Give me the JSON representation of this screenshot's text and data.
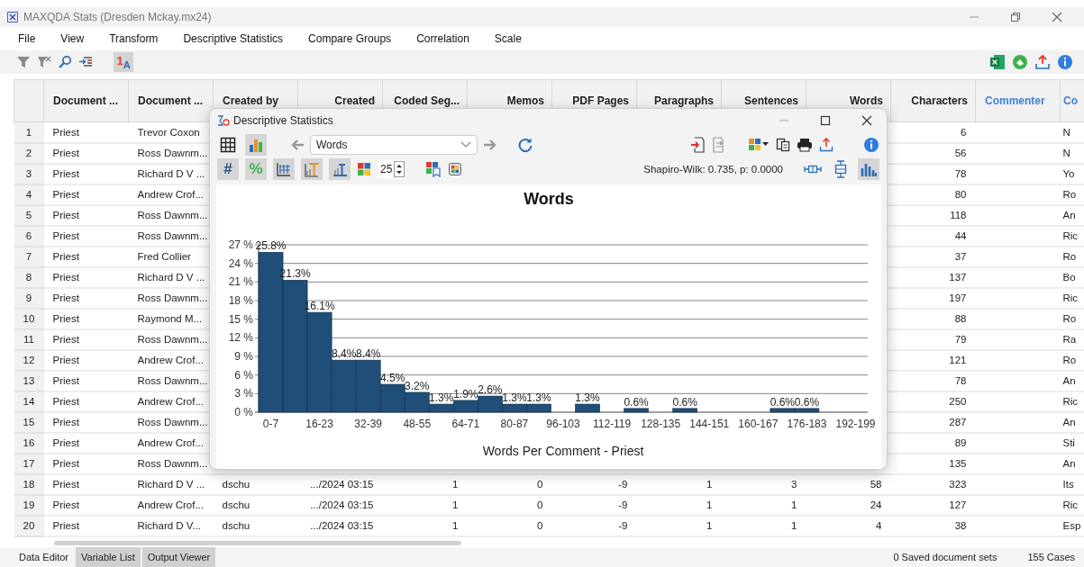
{
  "window": {
    "title": "MAXQDA Stats (Dresden Mckay.mx24)"
  },
  "menu": [
    "File",
    "View",
    "Transform",
    "Descriptive Statistics",
    "Compare Groups",
    "Correlation",
    "Scale"
  ],
  "toolbar": {
    "sort_button": {
      "label": "1$_{A}$",
      "selected": true
    }
  },
  "table": {
    "columns": [
      {
        "kind": "number"
      },
      {
        "label": "Document ...",
        "kind": "text"
      },
      {
        "label": "Document ...",
        "kind": "text"
      },
      {
        "label": "Created by",
        "kind": "text"
      },
      {
        "label": "Created",
        "kind": "number"
      },
      {
        "label": "Coded Seg...",
        "kind": "number"
      },
      {
        "label": "Memos",
        "kind": "number"
      },
      {
        "label": "PDF Pages",
        "kind": "number"
      },
      {
        "label": "Paragraphs",
        "kind": "number"
      },
      {
        "label": "Sentences",
        "kind": "number"
      },
      {
        "label": "Words",
        "kind": "number"
      },
      {
        "label": "Characters",
        "kind": "number"
      },
      {
        "label": "Commenter",
        "kind": "variable"
      },
      {
        "label": "Co",
        "kind": "variable"
      }
    ],
    "rows": [
      [
        "1",
        "Priest",
        "Trevor Coxon",
        null,
        null,
        null,
        null,
        null,
        null,
        null,
        null,
        "6",
        null,
        "N"
      ],
      [
        "2",
        "Priest",
        "Ross Dawnm...",
        null,
        null,
        null,
        null,
        null,
        null,
        null,
        null,
        "56",
        null,
        "N"
      ],
      [
        "3",
        "Priest",
        "Richard D V ...",
        null,
        null,
        null,
        null,
        null,
        null,
        null,
        null,
        "78",
        null,
        "Yo"
      ],
      [
        "4",
        "Priest",
        "Andrew Crof...",
        null,
        null,
        null,
        null,
        null,
        null,
        null,
        null,
        "80",
        null,
        "Ro"
      ],
      [
        "5",
        "Priest",
        "Ross Dawnm...",
        null,
        null,
        null,
        null,
        null,
        null,
        null,
        null,
        "118",
        null,
        "An"
      ],
      [
        "6",
        "Priest",
        "Ross Dawnm...",
        null,
        null,
        null,
        null,
        null,
        null,
        null,
        null,
        "44",
        null,
        "Ric"
      ],
      [
        "7",
        "Priest",
        "Fred Collier",
        null,
        null,
        null,
        null,
        null,
        null,
        null,
        null,
        "37",
        null,
        "Ro"
      ],
      [
        "8",
        "Priest",
        "Richard D V ...",
        null,
        null,
        null,
        null,
        null,
        null,
        null,
        null,
        "137",
        null,
        "Bo"
      ],
      [
        "9",
        "Priest",
        "Ross Dawnm...",
        null,
        null,
        null,
        null,
        null,
        null,
        null,
        null,
        "197",
        null,
        "Ric"
      ],
      [
        "10",
        "Priest",
        "Raymond M...",
        null,
        null,
        null,
        null,
        null,
        null,
        null,
        null,
        "88",
        null,
        "Ro"
      ],
      [
        "11",
        "Priest",
        "Ross Dawnm...",
        null,
        null,
        null,
        null,
        null,
        null,
        null,
        null,
        "79",
        null,
        "Ra"
      ],
      [
        "12",
        "Priest",
        "Andrew Crof...",
        null,
        null,
        null,
        null,
        null,
        null,
        null,
        null,
        "121",
        null,
        "Ro"
      ],
      [
        "13",
        "Priest",
        "Ross Dawnm...",
        null,
        null,
        null,
        null,
        null,
        null,
        null,
        null,
        "78",
        null,
        "An"
      ],
      [
        "14",
        "Priest",
        "Andrew Crof...",
        null,
        null,
        null,
        null,
        null,
        null,
        null,
        null,
        "250",
        null,
        "Ric"
      ],
      [
        "15",
        "Priest",
        "Ross Dawnm...",
        null,
        null,
        null,
        null,
        null,
        null,
        null,
        null,
        "287",
        null,
        "An"
      ],
      [
        "16",
        "Priest",
        "Andrew Crof...",
        null,
        null,
        null,
        null,
        null,
        null,
        null,
        null,
        "89",
        null,
        "Sti"
      ],
      [
        "17",
        "Priest",
        "Ross Dawnm...",
        null,
        null,
        null,
        null,
        null,
        null,
        null,
        null,
        "135",
        null,
        "An"
      ],
      [
        "18",
        "Priest",
        "Richard D V ...",
        "dschu",
        ".../2024 03:15",
        "1",
        "0",
        "-9",
        "1",
        "3",
        "58",
        "323",
        null,
        "Its"
      ],
      [
        "19",
        "Priest",
        "Andrew Crof...",
        "dschu",
        ".../2024 03:15",
        "1",
        "0",
        "-9",
        "1",
        "1",
        "24",
        "127",
        null,
        "Ric"
      ],
      [
        "20",
        "Priest",
        "Richard D V...",
        "dschu",
        ".../2024 03:15",
        "1",
        "0",
        "-9",
        "1",
        "1",
        "4",
        "38",
        null,
        "Esp"
      ]
    ]
  },
  "dialog": {
    "title": "Descriptive Statistics",
    "views": [
      {
        "kind": "table",
        "selected": false
      },
      {
        "kind": "chart",
        "selected": true
      }
    ],
    "variable_field": {
      "value": "Words"
    },
    "display_toggles": [
      {
        "kind": "text",
        "label": "#",
        "selected": true
      },
      {
        "kind": "text",
        "label": "%",
        "selected": true
      },
      {
        "kind": "grid",
        "selected": true
      },
      {
        "kind": "orange-bars",
        "selected": true
      },
      {
        "kind": "blue-bars",
        "selected": true
      }
    ],
    "bins": "25",
    "normality": "Shapiro-Wilk: 0.735, p: 0.0000",
    "plot_types": [
      {
        "kind": "boxplot-horizontal",
        "selected": false
      },
      {
        "kind": "boxplot-vertical",
        "selected": false
      },
      {
        "kind": "histogram",
        "selected": true
      }
    ],
    "chart_data": {
      "type": "bar",
      "title": "Words",
      "xlabel": "Words Per Comment - Priest",
      "categories": [
        "0-7",
        null,
        "16-23",
        null,
        "32-39",
        null,
        "48-55",
        null,
        "64-71",
        null,
        "80-87",
        null,
        "96-103",
        null,
        "112-119",
        null,
        "128-135",
        null,
        "144-151",
        null,
        "160-167",
        null,
        "176-183",
        null,
        "192-199"
      ],
      "value_labels": [
        "25.8%",
        "21.3%",
        "16.1%",
        "8.4%",
        "8.4%",
        "4.5%",
        "3.2%",
        "1.3%",
        "1.9%",
        "2.6%",
        "1.3%",
        "1.3%",
        null,
        "1.3%",
        null,
        "0.6%",
        null,
        "0.6%",
        null,
        null,
        null,
        "0.6%",
        "0.6%",
        null,
        null
      ],
      "ylim": [
        0,
        27
      ],
      "yticks": [
        {
          "value": 0,
          "label": "0 %"
        },
        {
          "value": 3,
          "label": "3 %"
        },
        {
          "value": 6,
          "label": "6 %"
        },
        {
          "value": 9,
          "label": "9 %"
        },
        {
          "value": 12,
          "label": "12 %"
        },
        {
          "value": 15,
          "label": "15 %"
        },
        {
          "value": 18,
          "label": "18 %"
        },
        {
          "value": 21,
          "label": "21 %"
        },
        {
          "value": 24,
          "label": "24 %"
        },
        {
          "value": 27,
          "label": "27 %"
        }
      ],
      "grid": true,
      "series": [
        {
          "color": "#1f4e79",
          "values": [
            25.8,
            21.3,
            16.1,
            8.4,
            8.4,
            4.5,
            3.2,
            1.3,
            1.9,
            2.6,
            1.3,
            1.3,
            0,
            1.3,
            0,
            0.6,
            0,
            0.6,
            0,
            0,
            0,
            0.6,
            0.6,
            0,
            0
          ]
        }
      ]
    }
  },
  "tabs": [
    {
      "label": "Data Editor",
      "selected": true
    },
    {
      "label": "Variable List",
      "selected": false
    },
    {
      "label": "Output Viewer",
      "selected": false
    }
  ],
  "status_bar": {
    "document_sets": "0 Saved document sets",
    "cases": "155 Cases"
  }
}
